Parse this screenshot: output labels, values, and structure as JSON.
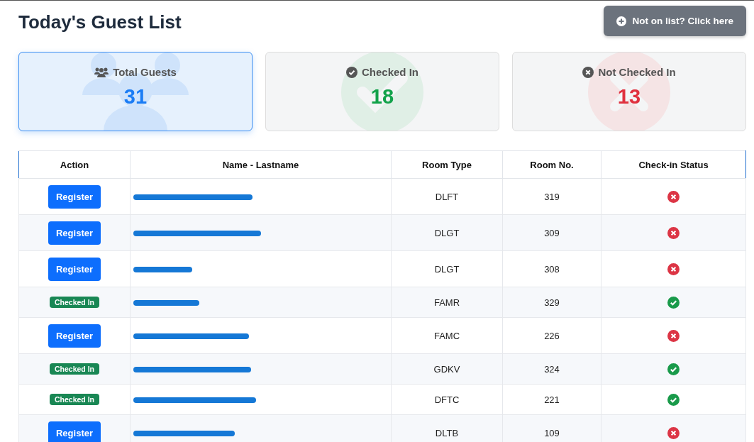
{
  "title": "Today's Guest List",
  "walk_in_button": {
    "label": "Not on list? Click here"
  },
  "stats": [
    {
      "kind": "total",
      "label": "Total Guests",
      "value": "31",
      "selected": true
    },
    {
      "kind": "checked",
      "label": "Checked In",
      "value": "18",
      "selected": false
    },
    {
      "kind": "not_checked",
      "label": "Not Checked In",
      "value": "13",
      "selected": false
    }
  ],
  "table": {
    "columns": [
      "Action",
      "Name - Lastname",
      "Room Type",
      "Room No.",
      "Check-in Status"
    ],
    "rows": [
      {
        "action": "Register",
        "checked_in": false,
        "name_redacted": true,
        "room_type": "DLFT",
        "room_no": "319"
      },
      {
        "action": "Register",
        "checked_in": false,
        "name_redacted": true,
        "room_type": "DLGT",
        "room_no": "309"
      },
      {
        "action": "Register",
        "checked_in": false,
        "name_redacted": true,
        "room_type": "DLGT",
        "room_no": "308"
      },
      {
        "action": "Checked In",
        "checked_in": true,
        "name_redacted": true,
        "room_type": "FAMR",
        "room_no": "329"
      },
      {
        "action": "Register",
        "checked_in": false,
        "name_redacted": true,
        "room_type": "FAMC",
        "room_no": "226"
      },
      {
        "action": "Checked In",
        "checked_in": true,
        "name_redacted": true,
        "room_type": "GDKV",
        "room_no": "324"
      },
      {
        "action": "Checked In",
        "checked_in": true,
        "name_redacted": true,
        "room_type": "DFTC",
        "room_no": "221"
      },
      {
        "action": "Register",
        "checked_in": false,
        "name_redacted": true,
        "room_type": "DLTB",
        "room_no": "109"
      }
    ]
  }
}
